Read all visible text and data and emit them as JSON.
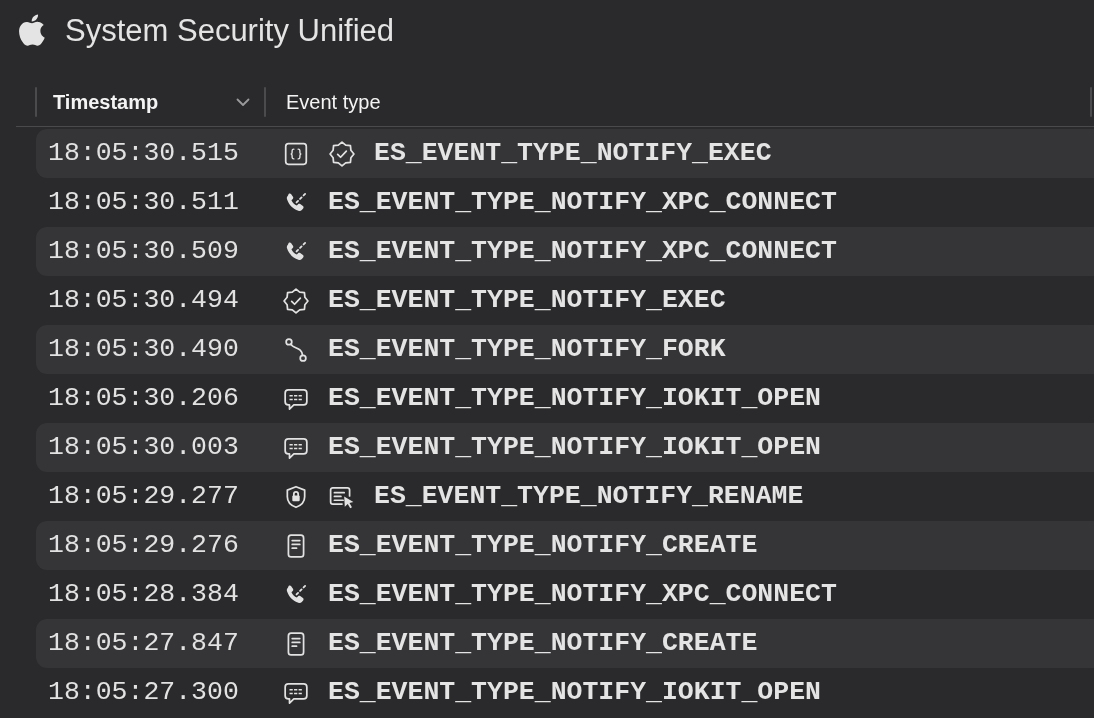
{
  "window": {
    "title": "System Security Unified"
  },
  "table": {
    "columns": [
      {
        "label": "Timestamp",
        "sorted": true
      },
      {
        "label": "Event type",
        "sorted": false
      }
    ],
    "rows": [
      {
        "timestamp": "18:05:30.515",
        "kind": "exec",
        "scripted": true,
        "locked": false,
        "event_type": "ES_EVENT_TYPE_NOTIFY_EXEC"
      },
      {
        "timestamp": "18:05:30.511",
        "kind": "connect",
        "scripted": false,
        "locked": false,
        "event_type": "ES_EVENT_TYPE_NOTIFY_XPC_CONNECT"
      },
      {
        "timestamp": "18:05:30.509",
        "kind": "connect",
        "scripted": false,
        "locked": false,
        "event_type": "ES_EVENT_TYPE_NOTIFY_XPC_CONNECT"
      },
      {
        "timestamp": "18:05:30.494",
        "kind": "exec",
        "scripted": false,
        "locked": false,
        "event_type": "ES_EVENT_TYPE_NOTIFY_EXEC"
      },
      {
        "timestamp": "18:05:30.490",
        "kind": "fork",
        "scripted": false,
        "locked": false,
        "event_type": "ES_EVENT_TYPE_NOTIFY_FORK"
      },
      {
        "timestamp": "18:05:30.206",
        "kind": "open",
        "scripted": false,
        "locked": false,
        "event_type": "ES_EVENT_TYPE_NOTIFY_IOKIT_OPEN"
      },
      {
        "timestamp": "18:05:30.003",
        "kind": "open",
        "scripted": false,
        "locked": false,
        "event_type": "ES_EVENT_TYPE_NOTIFY_IOKIT_OPEN"
      },
      {
        "timestamp": "18:05:29.277",
        "kind": "rename",
        "scripted": false,
        "locked": true,
        "event_type": "ES_EVENT_TYPE_NOTIFY_RENAME"
      },
      {
        "timestamp": "18:05:29.276",
        "kind": "create",
        "scripted": false,
        "locked": false,
        "event_type": "ES_EVENT_TYPE_NOTIFY_CREATE"
      },
      {
        "timestamp": "18:05:28.384",
        "kind": "connect",
        "scripted": false,
        "locked": false,
        "event_type": "ES_EVENT_TYPE_NOTIFY_XPC_CONNECT"
      },
      {
        "timestamp": "18:05:27.847",
        "kind": "create",
        "scripted": false,
        "locked": false,
        "event_type": "ES_EVENT_TYPE_NOTIFY_CREATE"
      },
      {
        "timestamp": "18:05:27.300",
        "kind": "open",
        "scripted": false,
        "locked": false,
        "event_type": "ES_EVENT_TYPE_NOTIFY_IOKIT_OPEN"
      }
    ]
  }
}
